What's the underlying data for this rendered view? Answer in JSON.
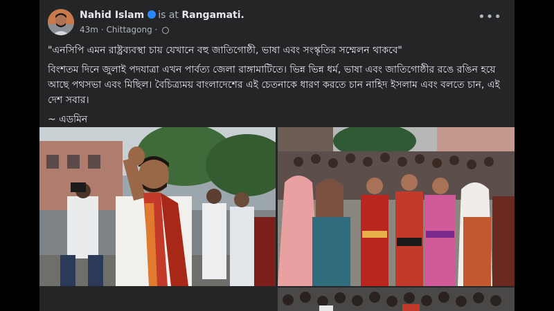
{
  "post": {
    "author": "Nahid Islam",
    "is_at": "is at",
    "place": "Rangamati.",
    "time": "43m",
    "location": "Chittagong",
    "sep": "·",
    "more": "•••",
    "quote": "\"এনসিপি এমন রাষ্ট্রব্যবস্থা চায় যেখানে বহু জাতিগোষ্ঠী, ভাষা এবং সংস্কৃতির সম্মেলন থাকবে\"",
    "body": "বিংশতম দিনে জুলাই পদযাত্রা এখন পার্বত্য জেলা রাঙ্গামাটিতে। ভিন্ন ভিন্ন  ধর্ম, ভাষা এবং জাতিগোষ্ঠীর রঙে রঙিন হয়ে আছে পথসভা এবং মিছিল। বৈচিত্র্যময় বাংলাদেশের এই চেতনাকে ধারণ করতে চান নাহিদ ইসলাম এবং বলতে চান, এই দেশ সবার।",
    "signature": "~ এডমিন"
  },
  "colors": {
    "background": "#000000",
    "card": "#242526",
    "text_primary": "#e4e6eb",
    "text_secondary": "#b0b3b8",
    "verified": "#2d88ff"
  },
  "icons": {
    "verified": "verified-badge-icon",
    "globe": "globe-icon",
    "more": "more-options-icon"
  }
}
